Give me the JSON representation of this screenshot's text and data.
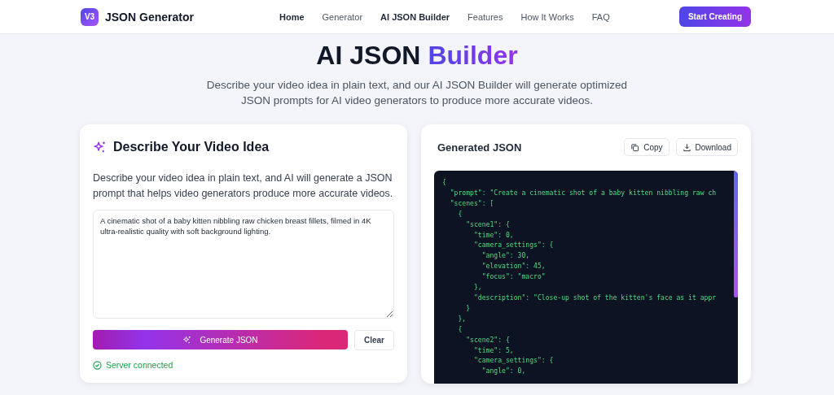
{
  "header": {
    "logo_badge": "V3",
    "brand": "JSON Generator",
    "nav": [
      {
        "label": "Home",
        "active": true
      },
      {
        "label": "Generator",
        "active": false
      },
      {
        "label": "AI JSON Builder",
        "active": true
      },
      {
        "label": "Features",
        "active": false
      },
      {
        "label": "How It Works",
        "active": false
      },
      {
        "label": "FAQ",
        "active": false
      }
    ],
    "cta": "Start Creating"
  },
  "hero": {
    "title": "AI JSON",
    "title_accent": "Builder",
    "subtitle": "Describe your video idea in plain text, and our AI JSON Builder will generate optimized JSON prompts for AI video generators to produce more accurate videos."
  },
  "input_card": {
    "title": "Describe Your Video Idea",
    "description": "Describe your video idea in plain text, and AI will generate a JSON prompt that helps video generators produce more accurate videos.",
    "textarea_value": "A cinematic shot of a baby kitten nibbling raw chicken breast fillets, filmed in 4K ultra-realistic quality with soft background lighting.",
    "generate_button": "Generate JSON",
    "clear_button": "Clear",
    "status": "Server connected",
    "connected": true
  },
  "output_card": {
    "title": "Generated JSON",
    "copy_button": "Copy",
    "download_button": "Download",
    "code_lines": [
      "{",
      "  \"prompt\": \"Create a cinematic shot of a baby kitten nibbling raw ch",
      "  \"scenes\": [",
      "    {",
      "      \"scene1\": {",
      "        \"time\": 0,",
      "        \"camera_settings\": {",
      "          \"angle\": 30,",
      "          \"elevation\": 45,",
      "          \"focus\": \"macro\"",
      "        },",
      "        \"description\": \"Close-up shot of the kitten's face as it appr",
      "      }",
      "    },",
      "    {",
      "      \"scene2\": {",
      "        \"time\": 5,",
      "        \"camera_settings\": {",
      "          \"angle\": 0,"
    ]
  }
}
